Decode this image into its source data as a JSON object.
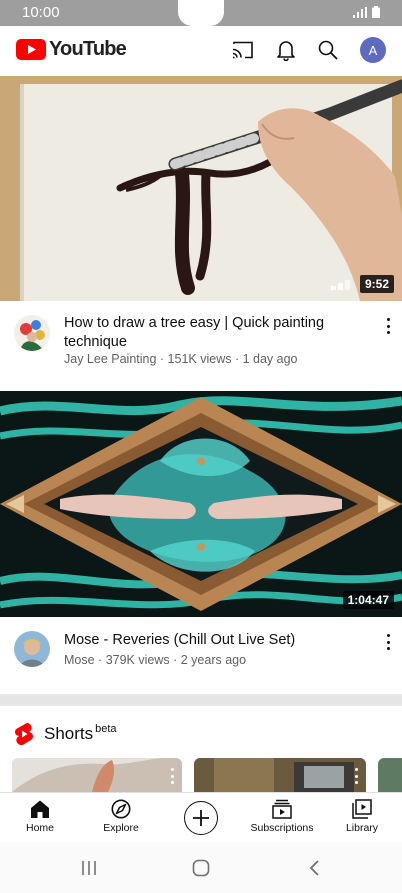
{
  "status_bar": {
    "time": "10:00"
  },
  "app_bar": {
    "logo_text": "YouTube",
    "avatar_initial": "A",
    "icons": [
      "cast-icon",
      "bell-icon",
      "search-icon"
    ]
  },
  "videos": [
    {
      "title": "How to draw a tree easy | Quick painting technique",
      "channel": "Jay Lee Painting",
      "views": "151K views",
      "age": "1 day ago",
      "duration": "9:52"
    },
    {
      "title": "Mose - Reveries (Chill Out Live Set)",
      "channel": "Mose",
      "views": "379K views",
      "age": "2 years ago",
      "duration": "1:04:47"
    }
  ],
  "shorts": {
    "label": "Shorts",
    "badge": "beta"
  },
  "bottom_nav": [
    {
      "label": "Home",
      "icon": "home-icon"
    },
    {
      "label": "Explore",
      "icon": "compass-icon"
    },
    {
      "label": "",
      "icon": "create-icon"
    },
    {
      "label": "Subscriptions",
      "icon": "subscriptions-icon"
    },
    {
      "label": "Library",
      "icon": "library-icon"
    }
  ],
  "colors": {
    "brand_red": "#ff0000",
    "avatar": "#5c6bc0",
    "secondary_text": "#606060"
  }
}
